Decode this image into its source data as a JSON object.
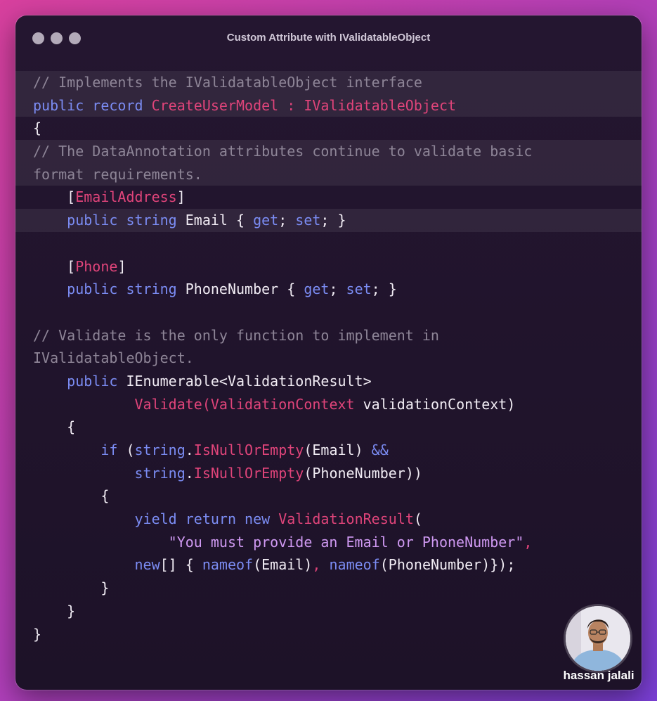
{
  "window": {
    "title": "Custom Attribute with IValidatableObject"
  },
  "colors": {
    "keyword": "#7b8cf3",
    "type": "#e0447a",
    "comment": "#8e8597",
    "string": "#cf99f2",
    "plain": "#f1ecf4"
  },
  "code": {
    "l1": "// Implements the IValidatableObject interface",
    "l2_kw": "public record ",
    "l2_ty": "CreateUserModel : IValidatableObject",
    "l3": "{",
    "l4": "// The DataAnnotation attributes continue to validate basic",
    "l5": "format requirements.",
    "l6_a": "    [",
    "l6_ty": "EmailAddress",
    "l6_b": "]",
    "l7_kw": "    public string ",
    "l7_a": "Email { ",
    "l7_get": "get",
    "l7_b": "; ",
    "l7_set": "set",
    "l7_c": "; }",
    "l9_a": "    [",
    "l9_ty": "Phone",
    "l9_b": "]",
    "l10_kw": "    public string ",
    "l10_a": "PhoneNumber { ",
    "l10_get": "get",
    "l10_b": "; ",
    "l10_set": "set",
    "l10_c": "; }",
    "l12": "// Validate is the only function to implement in",
    "l13": "IValidatableObject.",
    "l14_kw": "    public ",
    "l14_a": "IEnumerable<ValidationResult>",
    "l15_ty1": "            Validate",
    "l15_p1": "(",
    "l15_ty2": "ValidationContext",
    "l15_a": " validationContext)",
    "l16": "    {",
    "l17_kw1": "        if ",
    "l17_a": "(",
    "l17_kw2": "string",
    "l17_b": ".",
    "l17_ty": "IsNullOrEmpty",
    "l17_c": "(Email) ",
    "l17_kw3": "&&",
    "l18_kw": "            string",
    "l18_a": ".",
    "l18_ty": "IsNullOrEmpty",
    "l18_b": "(PhoneNumber))",
    "l19": "        {",
    "l20_kw": "            yield return new ",
    "l20_ty": "ValidationResult",
    "l20_a": "(",
    "l21_str": "                \"You must provide an Email or PhoneNumber\"",
    "l21_ty": ",",
    "l22_kw1": "            new",
    "l22_a": "[] { ",
    "l22_kw2": "nameof",
    "l22_b": "(Email)",
    "l22_ty": ", ",
    "l22_kw3": "nameof",
    "l22_c": "(PhoneNumber)});",
    "l23": "        }",
    "l24": "    }",
    "l25": "}"
  },
  "author": {
    "name": "hassan jalali"
  }
}
